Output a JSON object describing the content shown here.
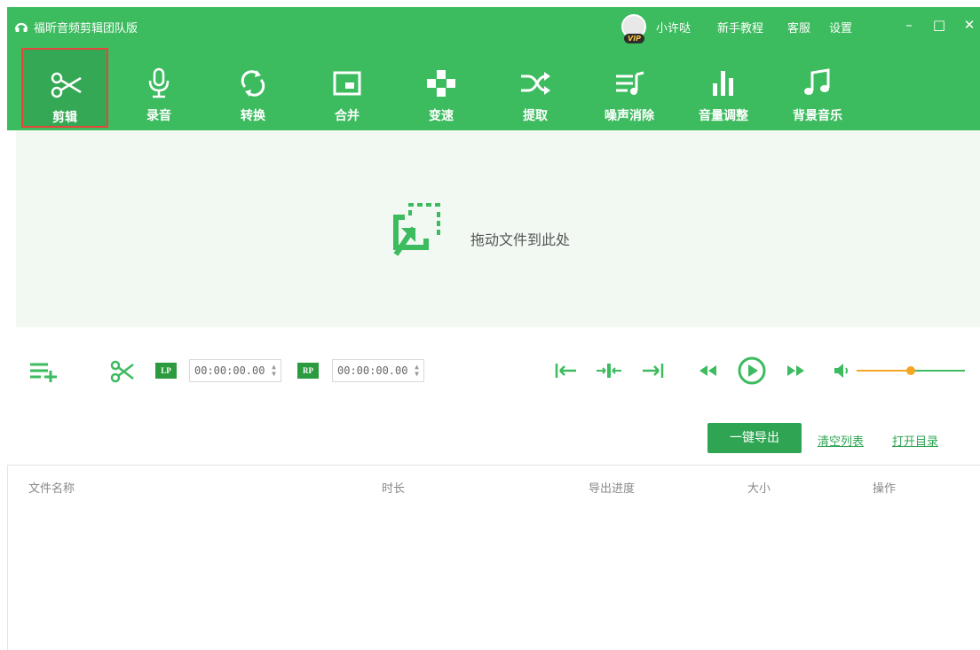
{
  "window": {
    "title": "福昕音频剪辑团队版",
    "user_name": "小许哒",
    "vip_label": "VIP",
    "menu": [
      "新手教程",
      "客服",
      "设置"
    ],
    "controls": {
      "minimize": "–",
      "maximize": "□",
      "close": "✕"
    }
  },
  "toolbar": {
    "active": "剪辑",
    "tools": [
      {
        "label": "剪辑",
        "icon": "scissors-icon"
      },
      {
        "label": "录音",
        "icon": "microphone-icon"
      },
      {
        "label": "转换",
        "icon": "convert-icon"
      },
      {
        "label": "合并",
        "icon": "merge-icon"
      },
      {
        "label": "变速",
        "icon": "speed-icon"
      },
      {
        "label": "提取",
        "icon": "shuffle-icon"
      },
      {
        "label": "噪声消除",
        "icon": "noise-icon"
      },
      {
        "label": "音量调整",
        "icon": "volume-bars-icon"
      },
      {
        "label": "背景音乐",
        "icon": "music-note-icon"
      }
    ]
  },
  "dropzone": {
    "text": "拖动文件到此处",
    "icon": "drag-file-icon"
  },
  "controls": {
    "lp_label": "LP",
    "lp_time": "00:00:00.00",
    "rp_label": "RP",
    "rp_time": "00:00:00.00",
    "volume_level": 0.5,
    "icons": [
      "add-list-icon",
      "cut-icon",
      "set-start-icon",
      "split-icon",
      "set-end-icon",
      "rewind-icon",
      "play-icon",
      "fast-forward-icon",
      "volume-icon"
    ]
  },
  "actions": {
    "export": "一键导出",
    "clear": "清空列表",
    "open_dir": "打开目录"
  },
  "table": {
    "columns": [
      "文件名称",
      "时长",
      "导出进度",
      "大小",
      "操作"
    ]
  },
  "colors": {
    "brand_green": "#3dbb5f",
    "dark_green": "#2fa553",
    "active_border": "#e8453c",
    "accent_orange": "#f5a623"
  }
}
